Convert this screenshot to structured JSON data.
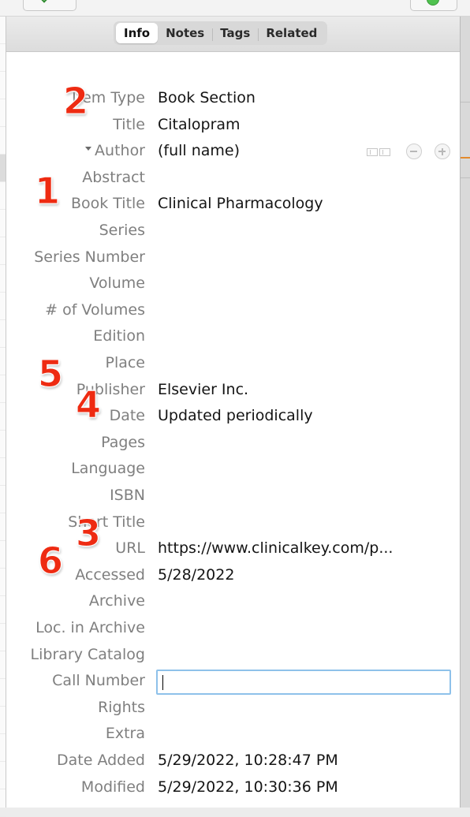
{
  "tabs": [
    {
      "label": "Info",
      "active": true
    },
    {
      "label": "Notes",
      "active": false
    },
    {
      "label": "Tags",
      "active": false
    },
    {
      "label": "Related",
      "active": false
    }
  ],
  "fields": [
    {
      "label": "Item Type",
      "value": "Book Section"
    },
    {
      "label": "Title",
      "value": "Citalopram"
    },
    {
      "label": "Author",
      "value": "(full name)",
      "creator": true
    },
    {
      "label": "Abstract",
      "value": ""
    },
    {
      "label": "Book Title",
      "value": "Clinical Pharmacology"
    },
    {
      "label": "Series",
      "value": ""
    },
    {
      "label": "Series Number",
      "value": ""
    },
    {
      "label": "Volume",
      "value": ""
    },
    {
      "label": "# of Volumes",
      "value": ""
    },
    {
      "label": "Edition",
      "value": ""
    },
    {
      "label": "Place",
      "value": ""
    },
    {
      "label": "Publisher",
      "value": "Elsevier Inc."
    },
    {
      "label": "Date",
      "value": "Updated periodically"
    },
    {
      "label": "Pages",
      "value": ""
    },
    {
      "label": "Language",
      "value": ""
    },
    {
      "label": "ISBN",
      "value": ""
    },
    {
      "label": "Short Title",
      "value": ""
    },
    {
      "label": "URL",
      "value": "https://www.clinicalkey.com/p..."
    },
    {
      "label": "Accessed",
      "value": "5/28/2022"
    },
    {
      "label": "Archive",
      "value": ""
    },
    {
      "label": "Loc. in Archive",
      "value": ""
    },
    {
      "label": "Library Catalog",
      "value": ""
    },
    {
      "label": "Call Number",
      "value": "",
      "editing": true
    },
    {
      "label": "Rights",
      "value": ""
    },
    {
      "label": "Extra",
      "value": ""
    },
    {
      "label": "Date Added",
      "value": "5/29/2022, 10:28:47 PM"
    },
    {
      "label": "Modified",
      "value": "5/29/2022, 10:30:36 PM"
    }
  ],
  "annotations": [
    {
      "number": "1",
      "field": "Book Title"
    },
    {
      "number": "2",
      "field": "Title"
    },
    {
      "number": "3",
      "field": "URL"
    },
    {
      "number": "4",
      "field": "Date"
    },
    {
      "number": "5",
      "field": "Publisher"
    },
    {
      "number": "6",
      "field": "Accessed"
    }
  ],
  "colors": {
    "label": "#7f7f7f",
    "value": "#141414",
    "badge": "#ee2b12",
    "focus_ring": "#8ec1ea"
  }
}
